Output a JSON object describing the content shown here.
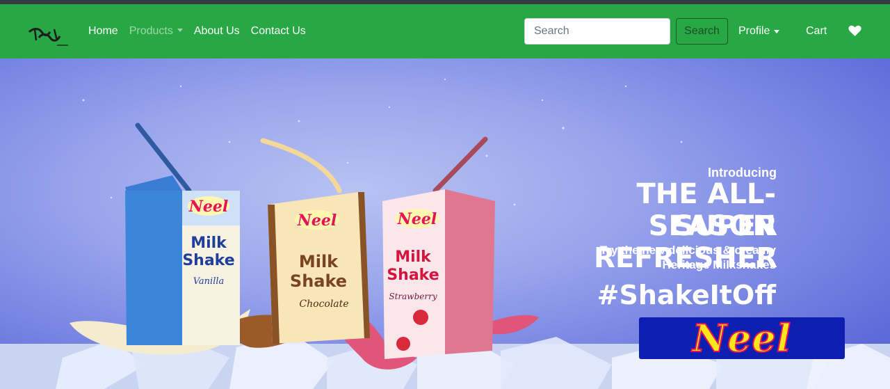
{
  "navbar": {
    "links": [
      {
        "label": "Home"
      },
      {
        "label": "Products"
      },
      {
        "label": "About Us"
      },
      {
        "label": "Contact Us"
      }
    ],
    "search": {
      "placeholder": "Search",
      "button_label": "Search"
    },
    "profile_label": "Profile",
    "cart_label": "Cart",
    "icons": {
      "brand": "logo-icon",
      "wishlist": "heart-icon"
    }
  },
  "hero": {
    "intro": "Introducing",
    "headline_line1": "THE ALL-SEASON",
    "headline_line2": "SUPER REFRESHER",
    "subline1": "Try the new delicious & creamy",
    "subline2": "Heritage Milkshakes",
    "hashtag": "#ShakeItOff",
    "brand": "Neel",
    "products": [
      {
        "brand": "Neel",
        "line1": "Milk",
        "line2": "Shake",
        "flavor": "Vanilla"
      },
      {
        "brand": "Neel",
        "line1": "Milk",
        "line2": "Shake",
        "flavor": "Chocolate"
      },
      {
        "brand": "Neel",
        "line1": "Milk",
        "line2": "Shake",
        "flavor": "Strawberry"
      }
    ]
  },
  "colors": {
    "navbar": "#28a745",
    "topbar": "#343a40",
    "hero_bg": "#8a96e8",
    "brand_box": "#0d1fb0",
    "brand_text": "#ffe61a"
  }
}
